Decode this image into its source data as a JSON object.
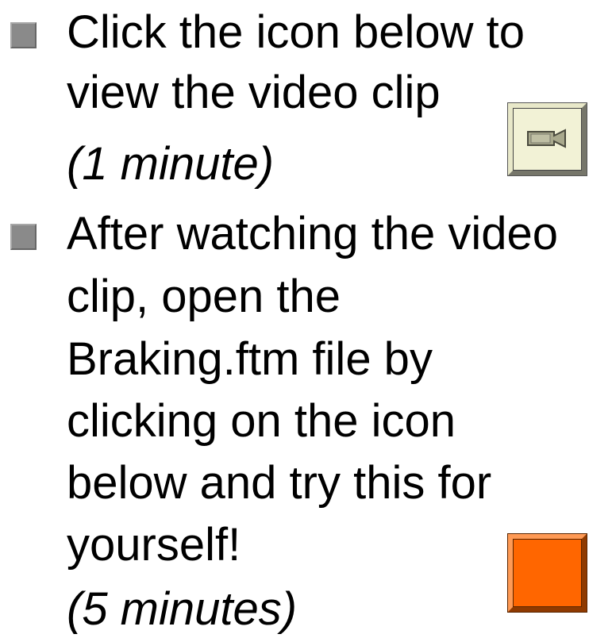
{
  "slide": {
    "bullet1": {
      "line1": "Click the icon below to",
      "line2": "view the video clip",
      "duration": "(1 minute)"
    },
    "bullet2": {
      "line1": "After watching the video",
      "line2": "clip, open the",
      "line3": "Braking.ftm file by",
      "line4": "clicking on the icon",
      "line5": "below and try this for",
      "line6": "yourself!",
      "duration": "(5 minutes)"
    }
  },
  "buttons": {
    "video_icon": "video-camera-icon",
    "file_icon": "braking-file-icon"
  },
  "colors": {
    "bullet": "#8a8a8a",
    "video_button_face": "#f2f2d6",
    "file_button_face": "#ff6600"
  }
}
